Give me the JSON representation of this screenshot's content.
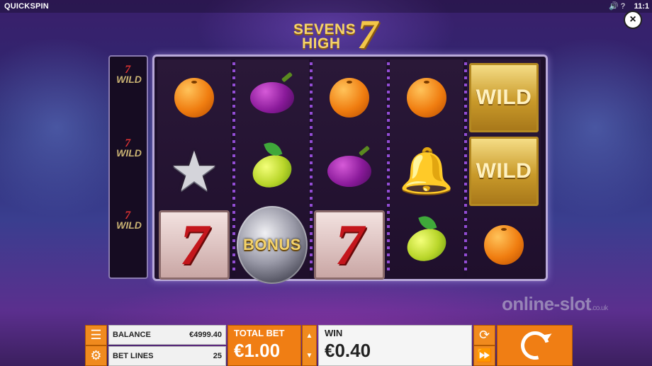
{
  "topbar": {
    "brand": "QUICKSPIN",
    "status_icons": "🔊 ?",
    "clock": "11:1"
  },
  "close": {
    "label": "×"
  },
  "logo": {
    "line1": "SEVENS",
    "line2": "HIGH",
    "seven": "7"
  },
  "side_panel": {
    "items": [
      {
        "label": "WILD",
        "mini": "7"
      },
      {
        "label": "WILD",
        "mini": "7"
      },
      {
        "label": "WILD",
        "mini": "7"
      }
    ]
  },
  "reels": {
    "symbol_labels": {
      "seven": "7",
      "bonus": "BONUS",
      "wild": "WILD"
    },
    "grid": [
      [
        "orange",
        "star",
        "seven"
      ],
      [
        "plum",
        "lemon",
        "bonus"
      ],
      [
        "orange",
        "plum",
        "seven"
      ],
      [
        "orange",
        "bell",
        "lemon"
      ],
      [
        "wild",
        "wild",
        "orange"
      ]
    ]
  },
  "watermark": {
    "main": "online-slot",
    "suffix": ".co.uk"
  },
  "panel": {
    "menu_icon": "menu-icon",
    "settings_icon": "gear-icon",
    "balance_label": "BALANCE",
    "balance_value": "€4999.40",
    "bet_lines_label": "BET LINES",
    "bet_lines_value": "25",
    "total_bet_label": "TOTAL BET",
    "total_bet_value": "€1.00",
    "win_label": "WIN",
    "win_value": "€0.40",
    "autoplay_icon": "autoplay-icon",
    "fast_icon": "fast-forward-icon",
    "spin_icon": "spin-icon"
  },
  "colors": {
    "accent": "#f07e14",
    "gold": "#f5d36a"
  }
}
